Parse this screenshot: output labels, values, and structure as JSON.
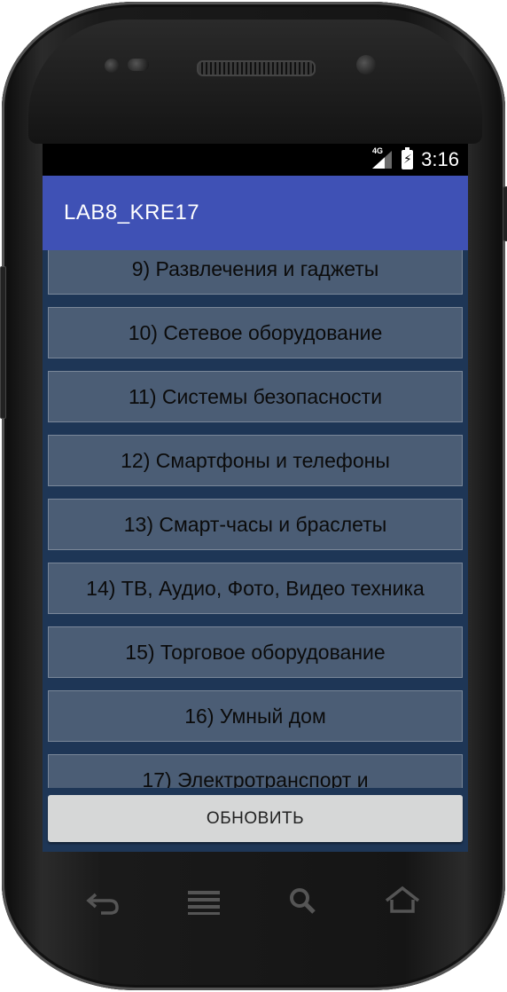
{
  "status_bar": {
    "network_label": "4G",
    "time": "3:16",
    "icons": [
      "signal-icon",
      "battery-charging-icon"
    ]
  },
  "app_bar": {
    "title": "LAB8_KRE17",
    "color": "#3f51b5"
  },
  "list": {
    "items": [
      "9) Развлечения и гаджеты",
      "10) Сетевое оборудование",
      "11) Системы безопасности",
      "12) Смартфоны и телефоны",
      "13) Смарт-часы и браслеты",
      "14) ТВ, Аудио, Фото, Видео техника",
      "15) Торговое оборудование",
      "16) Умный дом",
      "17) Электротранспорт и"
    ]
  },
  "refresh_button": {
    "label": "ОБНОВИТЬ"
  },
  "nav_bar": {
    "icons": [
      "back-icon",
      "menu-icon",
      "search-icon",
      "home-icon"
    ]
  },
  "colors": {
    "list_background": "#1e3656",
    "item_background": "#4b5d75",
    "button_background": "#d6d7d7"
  }
}
